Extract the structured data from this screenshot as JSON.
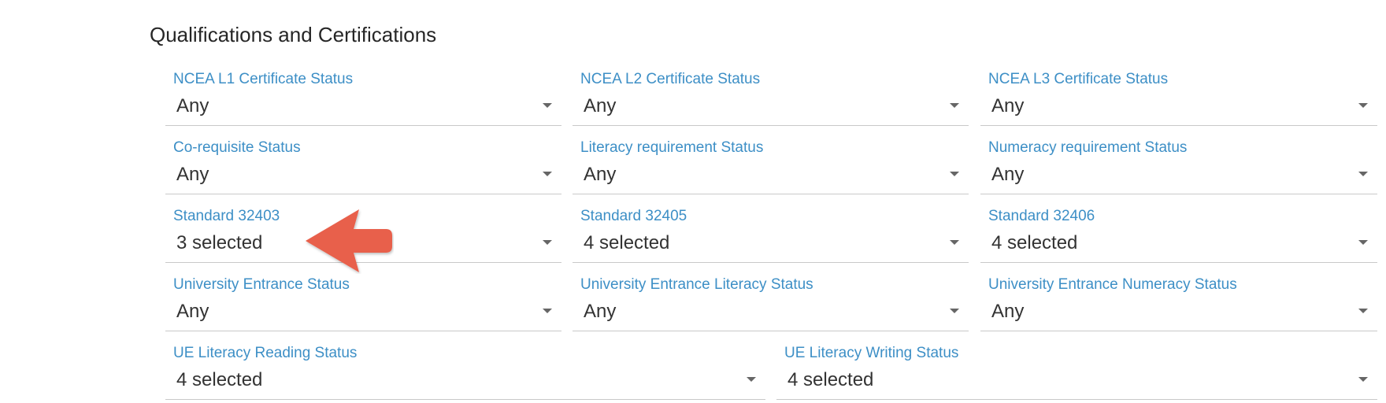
{
  "section": {
    "title": "Qualifications and Certifications"
  },
  "fields": {
    "ncea_l1": {
      "label": "NCEA L1 Certificate Status",
      "value": "Any"
    },
    "ncea_l2": {
      "label": "NCEA L2 Certificate Status",
      "value": "Any"
    },
    "ncea_l3": {
      "label": "NCEA L3 Certificate Status",
      "value": "Any"
    },
    "coreq": {
      "label": "Co-requisite Status",
      "value": "Any"
    },
    "literacy": {
      "label": "Literacy requirement Status",
      "value": "Any"
    },
    "numeracy": {
      "label": "Numeracy requirement Status",
      "value": "Any"
    },
    "std_32403": {
      "label": "Standard 32403",
      "value": "3 selected"
    },
    "std_32405": {
      "label": "Standard 32405",
      "value": "4 selected"
    },
    "std_32406": {
      "label": "Standard 32406",
      "value": "4 selected"
    },
    "ue_status": {
      "label": "University Entrance Status",
      "value": "Any"
    },
    "ue_literacy": {
      "label": "University Entrance Literacy Status",
      "value": "Any"
    },
    "ue_numeracy": {
      "label": "University Entrance Numeracy Status",
      "value": "Any"
    },
    "ue_lit_reading": {
      "label": "UE Literacy Reading Status",
      "value": "4 selected"
    },
    "ue_lit_writing": {
      "label": "UE Literacy Writing Status",
      "value": "4 selected"
    }
  },
  "annotation": {
    "arrow_color": "#e8604c"
  },
  "colors": {
    "label": "#3d8fc6",
    "value": "#333333",
    "underline": "#c9c9c9",
    "caret": "#666666"
  },
  "icons": {
    "dropdown": "chevron-down-icon",
    "annotation": "arrow-left-icon"
  }
}
